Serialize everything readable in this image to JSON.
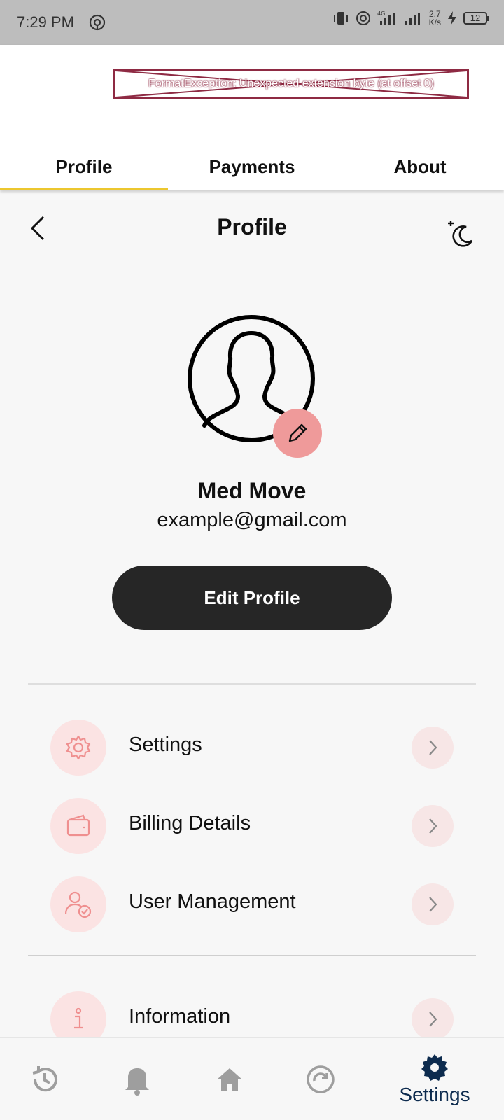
{
  "status_bar": {
    "time": "7:29 PM",
    "net_speed_value": "2.7",
    "net_speed_unit": "K/s",
    "battery": "12",
    "network": "4G"
  },
  "header": {
    "error_text": "FormatException: Unexpected extension byte (at offset 0)",
    "tabs": [
      {
        "label": "Profile",
        "active": true
      },
      {
        "label": "Payments",
        "active": false
      },
      {
        "label": "About",
        "active": false
      }
    ]
  },
  "page": {
    "title": "Profile",
    "back_icon": "chevron-left-icon",
    "theme_icon": "moon-icon"
  },
  "profile": {
    "name": "Med Move",
    "email": "example@gmail.com",
    "edit_button": "Edit Profile"
  },
  "menu": [
    {
      "label": "Settings",
      "icon": "gear-icon"
    },
    {
      "label": "Billing Details",
      "icon": "wallet-icon"
    },
    {
      "label": "User Management",
      "icon": "user-check-icon"
    },
    {
      "label": "Information",
      "icon": "info-icon"
    }
  ],
  "bottom_nav": {
    "active_label": "Settings",
    "items": [
      "history-icon",
      "bell-icon",
      "home-icon",
      "refresh-icon",
      "settings-icon"
    ]
  },
  "colors": {
    "accent_yellow": "#ecc72f",
    "accent_pink": "#ef9a9a",
    "nav_active": "#0d2b4e",
    "dark_button": "#262626"
  }
}
